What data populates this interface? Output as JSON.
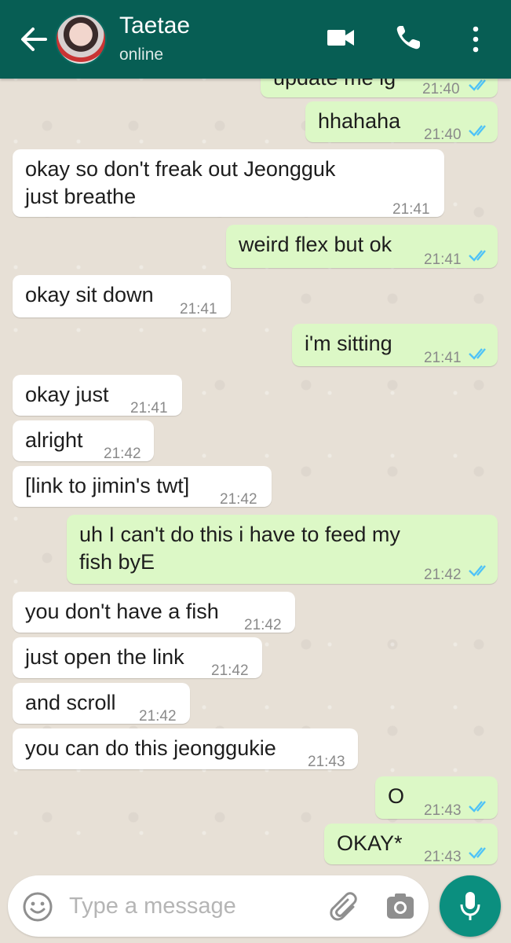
{
  "header": {
    "title": "Taetae",
    "status": "online"
  },
  "messages": [
    {
      "dir": "out",
      "text": "update me ig",
      "time": "21:40"
    },
    {
      "dir": "out",
      "text": "hhahaha",
      "time": "21:40"
    },
    {
      "dir": "in",
      "text": "okay so don't freak out Jeongguk",
      "text2": "just breathe",
      "time": "21:41"
    },
    {
      "dir": "out",
      "text": "weird flex but ok",
      "time": "21:41"
    },
    {
      "dir": "in",
      "text": "okay sit down",
      "time": "21:41"
    },
    {
      "dir": "out",
      "text": "i'm sitting",
      "time": "21:41"
    },
    {
      "dir": "in",
      "text": "okay just",
      "time": "21:41"
    },
    {
      "dir": "in",
      "text": "alright",
      "time": "21:42"
    },
    {
      "dir": "in",
      "text": "[link to jimin's twt]",
      "time": "21:42"
    },
    {
      "dir": "out",
      "text": "uh I can't do this i have to feed my",
      "text2": "fish byE",
      "time": "21:42"
    },
    {
      "dir": "in",
      "text": "you don't have a fish",
      "time": "21:42"
    },
    {
      "dir": "in",
      "text": "just open the link",
      "time": "21:42"
    },
    {
      "dir": "in",
      "text": "and scroll",
      "time": "21:42"
    },
    {
      "dir": "in",
      "text": "you can do this jeonggukie",
      "time": "21:43"
    },
    {
      "dir": "out",
      "text": "O",
      "time": "21:43"
    },
    {
      "dir": "out",
      "text": "OKAY*",
      "time": "21:43"
    }
  ],
  "composer": {
    "placeholder": "Type a message"
  },
  "colors": {
    "header": "#075e54",
    "outgoing_bubble": "#dcf8c6",
    "incoming_bubble": "#ffffff",
    "read_ticks": "#4fc3f7",
    "mic_button": "#0b8f7f"
  },
  "icons": [
    "back-arrow-icon",
    "video-call-icon",
    "phone-icon",
    "more-options-icon",
    "emoji-icon",
    "paperclip-icon",
    "camera-icon",
    "mic-icon",
    "double-check-icon"
  ]
}
